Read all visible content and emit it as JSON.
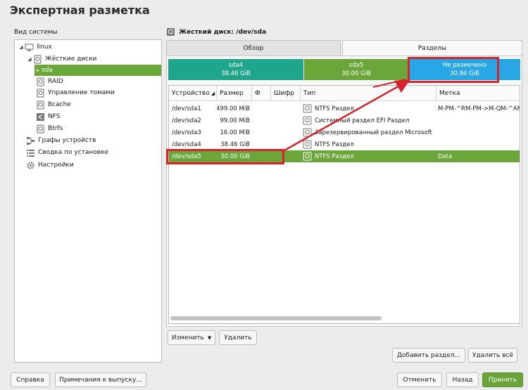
{
  "title": "Экспертная разметка",
  "sidebar": {
    "label": "Вид системы",
    "items": [
      {
        "label": "linux",
        "icon": "computer-icon"
      },
      {
        "label": "Жёсткие диски",
        "icon": "hard-disks-icon"
      },
      {
        "label": "sda",
        "icon": "disk-icon"
      },
      {
        "label": "RAID",
        "icon": "raid-icon"
      },
      {
        "label": "Управление томами",
        "icon": "volume-management-icon"
      },
      {
        "label": "Bcache",
        "icon": "bcache-icon"
      },
      {
        "label": "NFS",
        "icon": "nfs-icon"
      },
      {
        "label": "Btrfs",
        "icon": "btrfs-icon"
      },
      {
        "label": "Графы устройств",
        "icon": "device-graph-icon"
      },
      {
        "label": "Сводка по установке",
        "icon": "summary-icon"
      },
      {
        "label": "Настройки",
        "icon": "settings-gear-icon"
      }
    ]
  },
  "disk_header": "Жесткий диск: /dev/sda",
  "tabs": [
    {
      "label": "Обзор"
    },
    {
      "label": "Разделы"
    }
  ],
  "bars": [
    {
      "name": "sda4",
      "size": "38.46 GiB",
      "color": "#1ea58a"
    },
    {
      "name": "sda5",
      "size": "30.00 GiB",
      "color": "#6aa63a"
    },
    {
      "name": "Не размечено",
      "size": "30.94 GiB",
      "color": "#29a6e5"
    }
  ],
  "table": {
    "columns": [
      "Устройство",
      "Размер",
      "Ф",
      "Шифр",
      "Тип",
      "Метка"
    ],
    "rows": [
      {
        "device": "/dev/sda1",
        "size": "499.00 MiB",
        "type": "NTFS Раздел",
        "label": "M-PM-^RM-PM->M-QM-^AM"
      },
      {
        "device": "/dev/sda2",
        "size": "99.00 MiB",
        "type": "Системный раздел EFI Раздел",
        "label": ""
      },
      {
        "device": "/dev/sda3",
        "size": "16.00 MiB",
        "type": "Зарезервированный раздел Microsoft",
        "label": ""
      },
      {
        "device": "/dev/sda4",
        "size": "38.46 GiB",
        "type": "NTFS Раздел",
        "label": ""
      },
      {
        "device": "/dev/sda5",
        "size": "30.00 GiB",
        "type": "NTFS Раздел",
        "label": "Data"
      }
    ]
  },
  "buttons": {
    "edit": "Изменить",
    "delete": "Удалить",
    "add_partition": "Добавить раздел...",
    "delete_all": "Удалить всё",
    "help": "Справка",
    "release_notes": "Примечания к выпуску...",
    "cancel": "Отменить",
    "back": "Назад",
    "accept": "Принять"
  },
  "colors": {
    "accent": "#6aa63a",
    "highlight": "#d8222c"
  }
}
